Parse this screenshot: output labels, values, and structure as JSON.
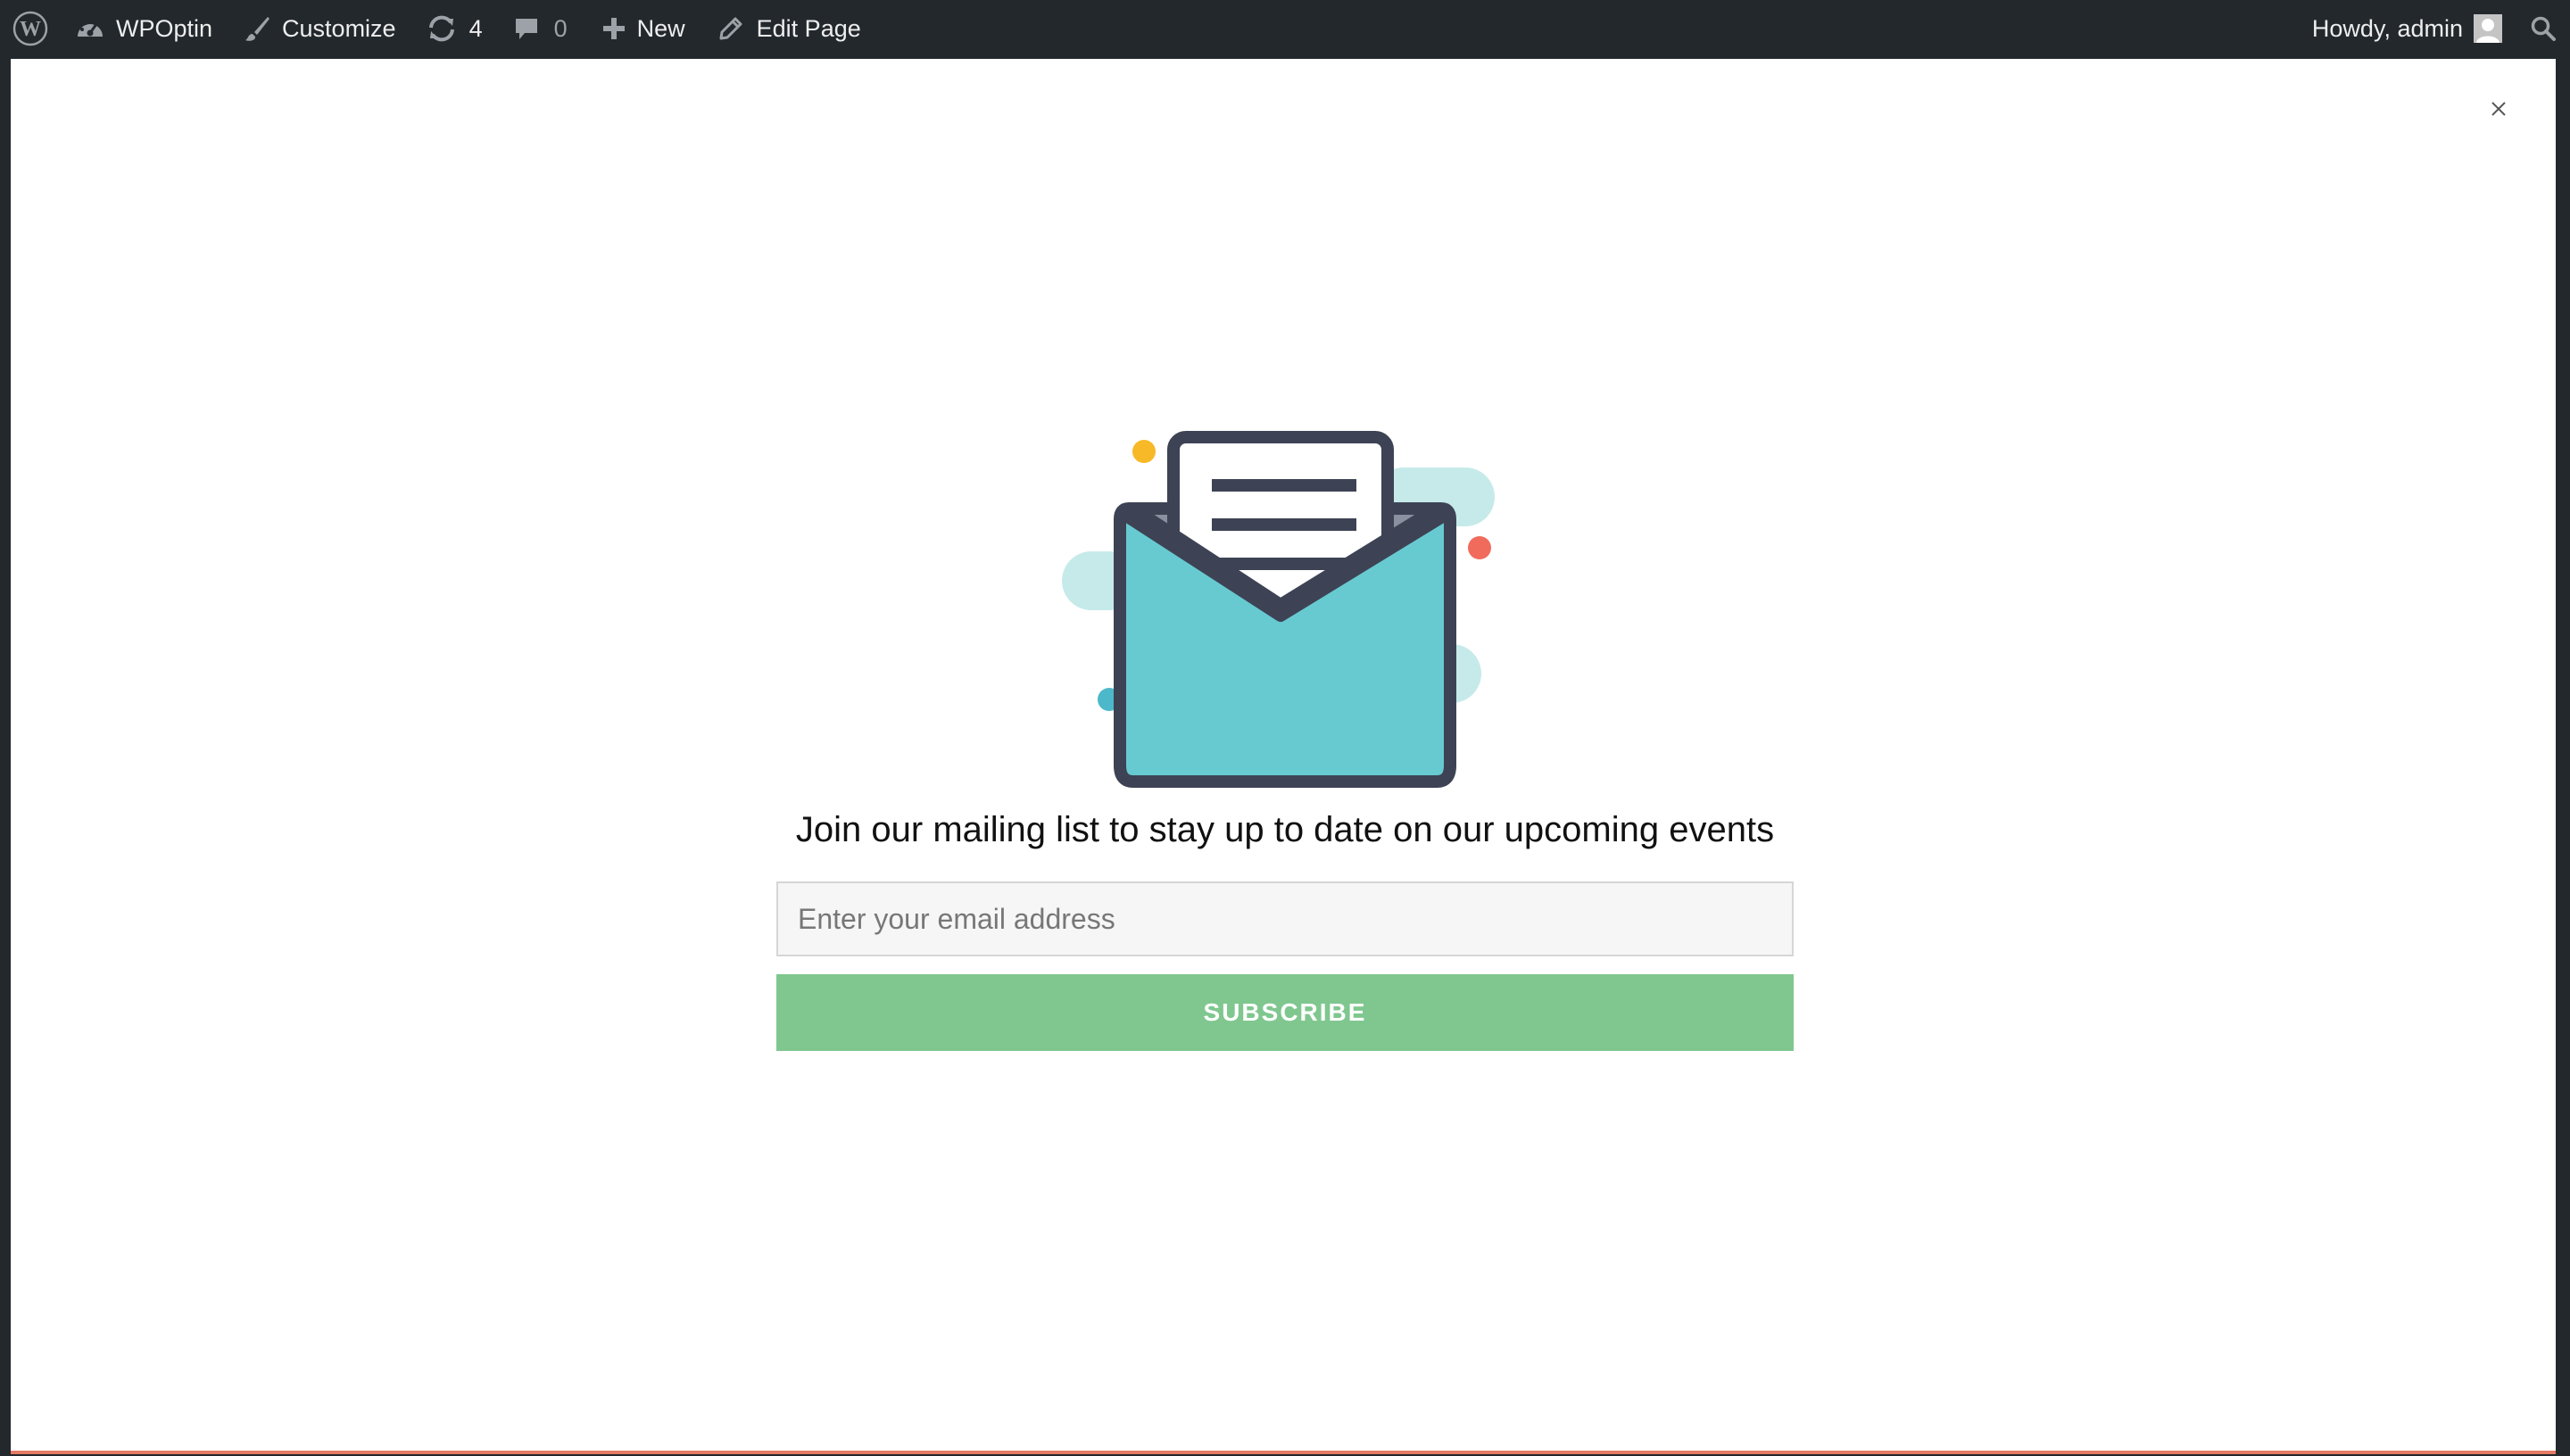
{
  "admin_bar": {
    "site_name": "WPOptin",
    "customize_label": "Customize",
    "updates_count": "4",
    "comments_count": "0",
    "new_label": "New",
    "edit_label": "Edit Page",
    "howdy_label": "Howdy, admin"
  },
  "optin": {
    "close_symbol": "×",
    "headline": "Join our mailing list to stay up to date on our upcoming events",
    "email_placeholder": "Enter your email address",
    "button_label": "SUBSCRIBE",
    "illustration_icon": "open-envelope-with-letter-icon"
  },
  "colors": {
    "admin_bar_bg": "#23282d",
    "button_bg": "#7fc78f",
    "envelope_fill": "#68cad1",
    "envelope_outline": "#3d4354",
    "bottom_accent": "#e57b64"
  }
}
